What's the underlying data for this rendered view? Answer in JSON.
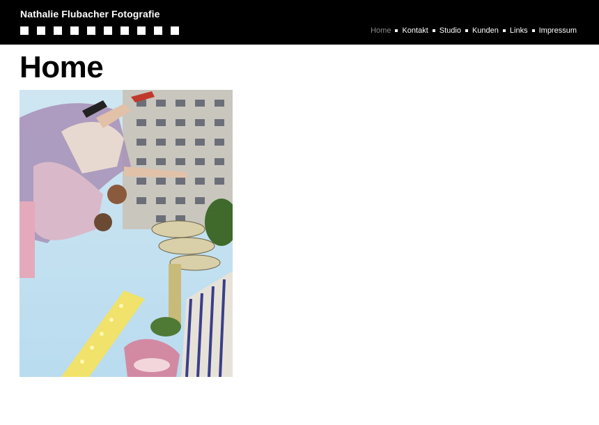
{
  "header": {
    "site_title": "Nathalie Flubacher Fotografie",
    "background_color": "#000000",
    "square_count": 10
  },
  "nav": {
    "items": [
      {
        "label": "Home",
        "active": true
      },
      {
        "label": "Kontakt",
        "active": false
      },
      {
        "label": "Studio",
        "active": false
      },
      {
        "label": "Kunden",
        "active": false
      },
      {
        "label": "Links",
        "active": false
      },
      {
        "label": "Impressum",
        "active": false
      }
    ],
    "active_color": "#8a8a8a",
    "color": "#ffffff"
  },
  "main": {
    "page_title": "Home",
    "photo_icon": "photo-amusement-ride"
  }
}
